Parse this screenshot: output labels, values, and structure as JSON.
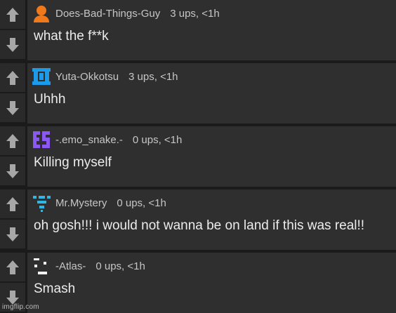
{
  "comments": [
    {
      "username": "Does-Bad-Things-Guy",
      "stats": "3 ups, <1h",
      "text": "what the f**k",
      "avatar_icon": "orange-person-icon",
      "avatar_color": "#f07a1b"
    },
    {
      "username": "Yuta-Okkotsu",
      "stats": "3 ups, <1h",
      "text": "Uhhh",
      "avatar_icon": "blue-pixel-pattern-icon",
      "avatar_color": "#1e9be8"
    },
    {
      "username": "-.emo_snake.-",
      "stats": "0 ups, <1h",
      "text": "Killing myself",
      "avatar_icon": "purple-pixel-pattern-icon",
      "avatar_color": "#8c58f2"
    },
    {
      "username": "Mr.Mystery",
      "stats": "0 ups, <1h",
      "text": "oh gosh!!! i would not wanna be on land if this was real!!",
      "avatar_icon": "cyan-pixel-pattern-icon",
      "avatar_color": "#2bb7e8"
    },
    {
      "username": "-Atlas-",
      "stats": "0 ups, <1h",
      "text": "Smash",
      "avatar_icon": "white-pixel-pattern-icon",
      "avatar_color": "#f2f2f2"
    }
  ],
  "icons": {
    "upvote": "upvote-arrow-icon",
    "downvote": "downvote-arrow-icon"
  },
  "colors": {
    "background": "#1b1b1b",
    "comment_body": "#2f2f30",
    "vote_button": "#2a2a2b",
    "vote_arrow": "#a7a7a7",
    "text": "#ececec",
    "meta_text": "#c6c6c6"
  },
  "watermark": "imgflip.com"
}
